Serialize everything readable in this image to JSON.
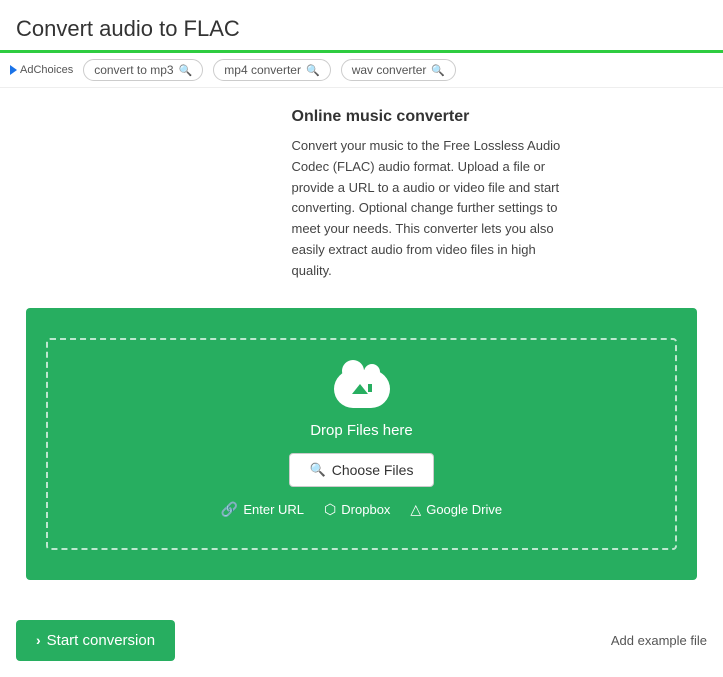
{
  "header": {
    "title": "Convert audio to FLAC",
    "accent_color": "#2ecc40"
  },
  "ad_bar": {
    "ad_choices_label": "AdChoices",
    "tags": [
      {
        "label": "convert to mp3"
      },
      {
        "label": "mp4 converter"
      },
      {
        "label": "wav converter"
      }
    ]
  },
  "description": {
    "heading": "Online music converter",
    "body": "Convert your music to the Free Lossless Audio Codec (FLAC) audio format. Upload a file or provide a URL to a audio or video file and start converting. Optional change further settings to meet your needs. This converter lets you also easily extract audio from video files in high quality."
  },
  "upload": {
    "drop_text": "Drop Files here",
    "choose_files_label": "Choose Files",
    "enter_url_label": "Enter URL",
    "dropbox_label": "Dropbox",
    "google_drive_label": "Google Drive"
  },
  "footer": {
    "start_conversion_label": "Start conversion",
    "add_example_label": "Add example file"
  },
  "colors": {
    "green": "#27ae60",
    "green_light": "#2ecc40"
  }
}
